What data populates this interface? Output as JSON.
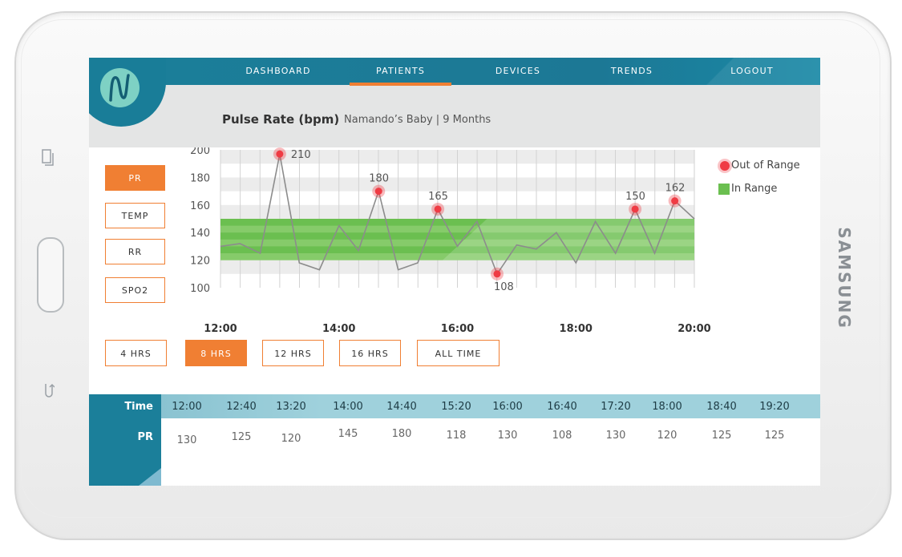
{
  "nav": {
    "items": [
      "DASHBOARD",
      "PATIENTS",
      "DEVICES",
      "TRENDS",
      "LOGOUT"
    ],
    "active": "PATIENTS"
  },
  "header": {
    "title": "Pulse Rate (bpm)",
    "subtitle": "Namando’s Baby  |  9 Months"
  },
  "side_tabs": [
    "PR",
    "TEMP",
    "RR",
    "SPO2"
  ],
  "range_tabs": [
    "4 HRS",
    "8 HRS",
    "12 HRS",
    "16 HRS",
    "ALL TIME"
  ],
  "device": {
    "brand": "SAMSUNG"
  },
  "colors": {
    "accent": "#f07f33",
    "teal": "#1b7f9a",
    "in_range": "#6bbf50",
    "out_of_range": "#ef3b44"
  },
  "chart_data": {
    "type": "line",
    "xlabel": "",
    "ylabel": "",
    "y_ticks": [
      "200",
      "180",
      "160",
      "140",
      "120",
      "100"
    ],
    "x_ticks": [
      "12:00",
      "14:00",
      "16:00",
      "18:00",
      "20:00"
    ],
    "ylim": [
      100,
      200
    ],
    "legend": [
      {
        "label": "Out of Range",
        "kind": "dot"
      },
      {
        "label": "In Range",
        "kind": "square"
      }
    ],
    "in_range_band": [
      120,
      150
    ],
    "series_points_hours": [
      12.0,
      12.33,
      12.67,
      13.0,
      13.33,
      13.67,
      14.0,
      14.33,
      14.67,
      15.0,
      15.33,
      15.67,
      16.0,
      16.33,
      16.67,
      17.0,
      17.33,
      17.67,
      18.0,
      18.33,
      18.67,
      19.0,
      19.33,
      19.67,
      20.0
    ],
    "series_values": [
      130,
      132,
      125,
      197,
      118,
      113,
      145,
      127,
      170,
      113,
      118,
      157,
      130,
      148,
      110,
      131,
      128,
      140,
      118,
      148,
      125,
      157,
      125,
      163,
      150
    ],
    "annotations": [
      {
        "x": 13.0,
        "y": 197,
        "label": "210"
      },
      {
        "x": 14.67,
        "y": 170,
        "label": "180"
      },
      {
        "x": 15.67,
        "y": 157,
        "label": "165"
      },
      {
        "x": 16.67,
        "y": 110,
        "label": "108"
      },
      {
        "x": 19.0,
        "y": 157,
        "label": "150"
      },
      {
        "x": 19.67,
        "y": 163,
        "label": "162"
      }
    ]
  },
  "table": {
    "row_labels": [
      "Time",
      "PR"
    ],
    "times": [
      "12:00",
      "12:40",
      "13:20",
      "14:00",
      "14:40",
      "15:20",
      "16:00",
      "16:40",
      "17:20",
      "18:00",
      "18:40",
      "19:20"
    ],
    "values": [
      "130",
      "125",
      "120",
      "145",
      "180",
      "118",
      "130",
      "108",
      "130",
      "120",
      "125",
      "125"
    ]
  }
}
